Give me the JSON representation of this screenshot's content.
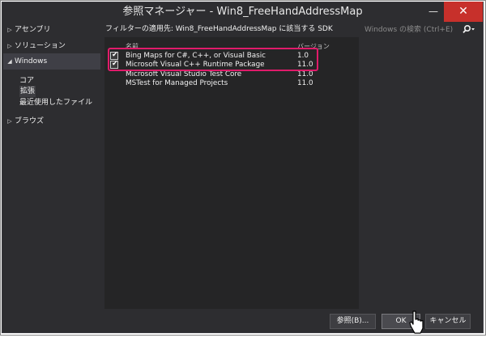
{
  "window": {
    "title": "参照マネージャー - Win8_FreeHandAddressMap",
    "minimize_label": "—",
    "close_label": "✕"
  },
  "help_label": "?",
  "sidebar": {
    "items": [
      {
        "label": "アセンブリ",
        "expanded": false
      },
      {
        "label": "ソリューション",
        "expanded": false
      },
      {
        "label": "Windows",
        "expanded": true,
        "selected": true
      },
      {
        "label": "ブラウズ",
        "expanded": false
      }
    ],
    "windows_children": [
      {
        "label": "コア"
      },
      {
        "label": "拡張",
        "selected": true
      },
      {
        "label": "最近使用したファイル"
      }
    ]
  },
  "filter_text": "フィルターの適用先: Win8_FreeHandAddressMap に該当する SDK",
  "columns": {
    "name": "名前",
    "version": "バージョン"
  },
  "rows": [
    {
      "name": "Bing Maps for C#, C++, or Visual Basic",
      "version": "1.0",
      "checked": true
    },
    {
      "name": "Microsoft Visual C++ Runtime Package",
      "version": "11.0",
      "checked": true
    },
    {
      "name": "Microsoft Visual Studio Test Core",
      "version": "11.0",
      "checked": false
    },
    {
      "name": "MSTest for Managed Projects",
      "version": "11.0",
      "checked": false
    }
  ],
  "search": {
    "placeholder": "Windows の検索 (Ctrl+E)"
  },
  "buttons": {
    "browse": "参照(B)...",
    "ok": "OK",
    "cancel": "キャンセル"
  },
  "colors": {
    "highlight": "#e01b6a",
    "close": "#c7302b"
  }
}
